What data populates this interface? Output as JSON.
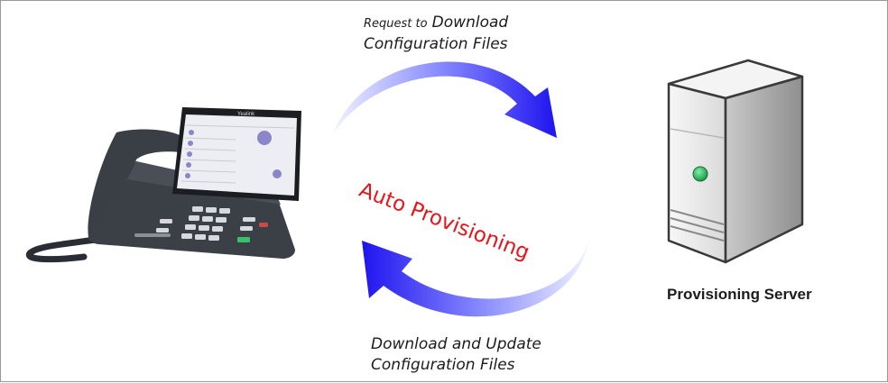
{
  "diagram": {
    "request_line1_small": "Request to",
    "request_line1_big": "Download",
    "request_line2": "Configuration Files",
    "center_label": "Auto Provisioning",
    "download_line1": "Download and Update",
    "download_line2": "Configuration Files",
    "server_label": "Provisioning Server",
    "phone_brand": "Yealink",
    "colors": {
      "arrow_dark": "#1e14ef",
      "arrow_light": "#e6e8ff",
      "label_red": "#e8141b",
      "server_led": "#1fae54"
    }
  }
}
